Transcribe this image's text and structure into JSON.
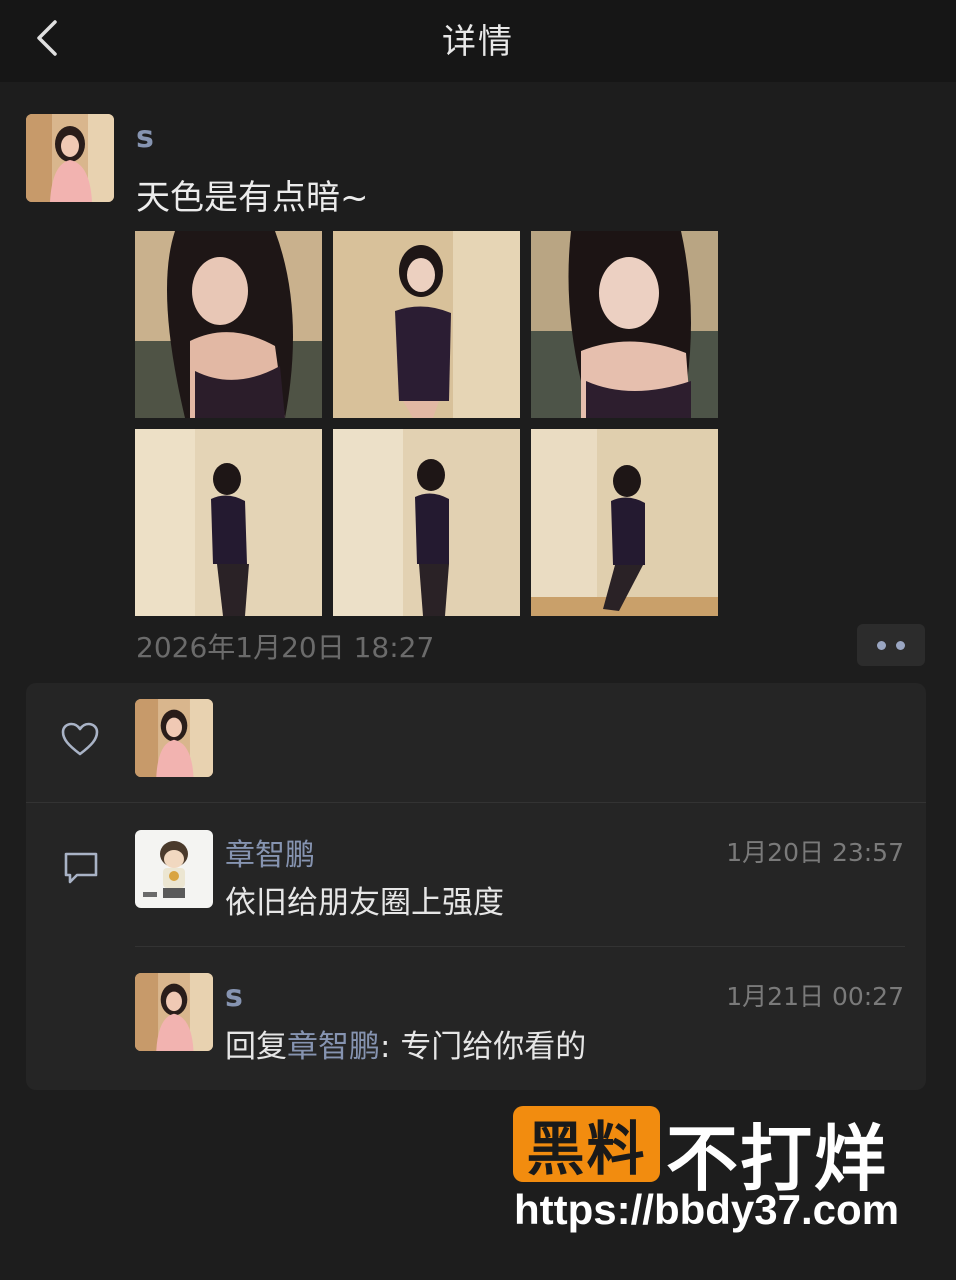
{
  "nav": {
    "title": "详情",
    "back_icon": "chevron-left-icon"
  },
  "post": {
    "author": "s",
    "text": "天色是有点暗~",
    "photo_count": 6,
    "time": "2026年1月20日 18:27",
    "more_icon": "more-dots-icon"
  },
  "likes": {
    "icon": "heart-icon",
    "users": [
      "s"
    ]
  },
  "comments": {
    "icon": "comment-icon",
    "items": [
      {
        "name": "章智鹏",
        "time": "1月20日 23:57",
        "text": "依旧给朋友圈上强度"
      },
      {
        "name": "s",
        "time": "1月21日 00:27",
        "reply_prefix": "回复",
        "reply_to": "章智鹏",
        "reply_sep": ": ",
        "text": "专门给你看的"
      }
    ]
  },
  "watermark": {
    "badge": "黑料",
    "brand": "不打烊",
    "url": "https://bbdy37.com",
    "badge_color": "#f28c0f"
  },
  "colors": {
    "background": "#1d1d1d",
    "name_link": "#8694b1",
    "panel": "#252525"
  }
}
